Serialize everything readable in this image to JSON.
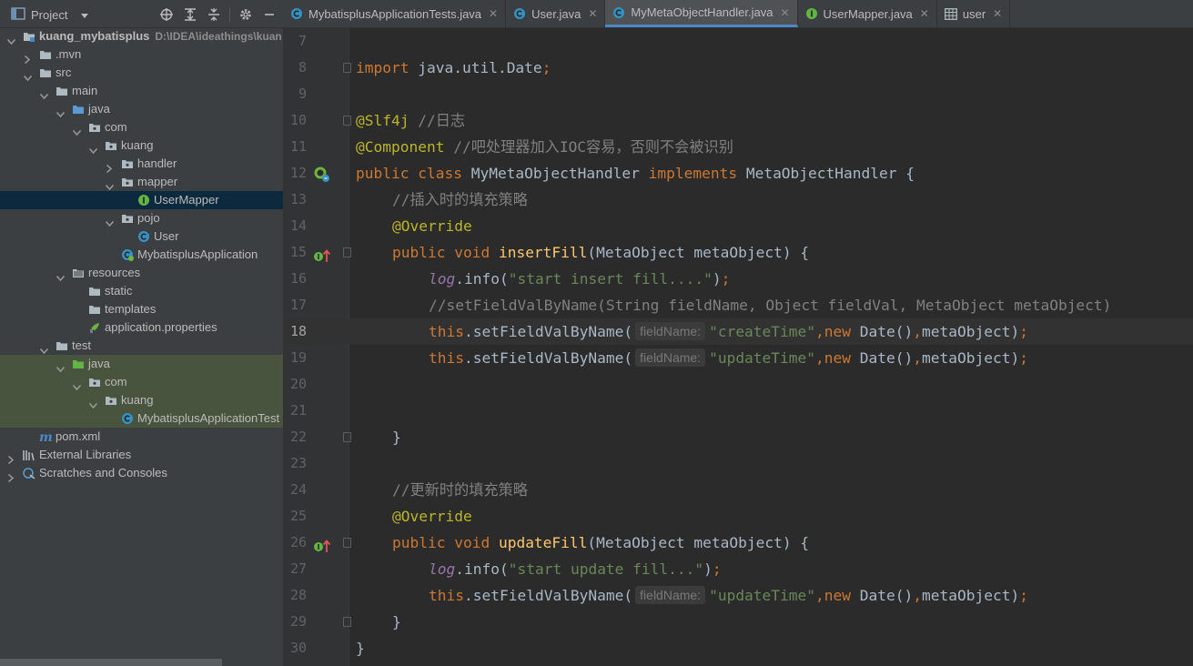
{
  "project": {
    "title": "Project",
    "tree": [
      {
        "label": "kuang_mybatisplus",
        "path": "D:\\IDEA\\ideathings\\kuan",
        "icon": "module-folder-icon",
        "depth": 0,
        "arrow": "down",
        "bold": true
      },
      {
        "label": ".mvn",
        "icon": "folder-icon",
        "depth": 1,
        "arrow": "right"
      },
      {
        "label": "src",
        "icon": "folder-icon",
        "depth": 1,
        "arrow": "down"
      },
      {
        "label": "main",
        "icon": "folder-icon",
        "depth": 2,
        "arrow": "down"
      },
      {
        "label": "java",
        "icon": "source-folder-icon",
        "depth": 3,
        "arrow": "down"
      },
      {
        "label": "com",
        "icon": "package-icon",
        "depth": 4,
        "arrow": "down"
      },
      {
        "label": "kuang",
        "icon": "package-icon",
        "depth": 5,
        "arrow": "down"
      },
      {
        "label": "handler",
        "icon": "package-icon",
        "depth": 6,
        "arrow": "right"
      },
      {
        "label": "mapper",
        "icon": "package-icon",
        "depth": 6,
        "arrow": "down"
      },
      {
        "label": "UserMapper",
        "icon": "interface-icon",
        "depth": 7,
        "arrow": "none",
        "selected": true
      },
      {
        "label": "pojo",
        "icon": "package-icon",
        "depth": 6,
        "arrow": "down"
      },
      {
        "label": "User",
        "icon": "class-icon",
        "depth": 7,
        "arrow": "none"
      },
      {
        "label": "MybatisplusApplication",
        "icon": "spring-boot-class-icon",
        "depth": 6,
        "arrow": "none"
      },
      {
        "label": "resources",
        "icon": "resources-folder-icon",
        "depth": 3,
        "arrow": "down"
      },
      {
        "label": "static",
        "icon": "folder-icon",
        "depth": 4,
        "arrow": "none"
      },
      {
        "label": "templates",
        "icon": "folder-icon",
        "depth": 4,
        "arrow": "none"
      },
      {
        "label": "application.properties",
        "icon": "properties-file-icon",
        "depth": 4,
        "arrow": "none"
      },
      {
        "label": "test",
        "icon": "folder-icon",
        "depth": 2,
        "arrow": "down"
      },
      {
        "label": "java",
        "icon": "test-source-folder-icon",
        "depth": 3,
        "arrow": "down",
        "test": true
      },
      {
        "label": "com",
        "icon": "package-icon",
        "depth": 4,
        "arrow": "down",
        "test": true
      },
      {
        "label": "kuang",
        "icon": "package-icon",
        "depth": 5,
        "arrow": "down",
        "test": true
      },
      {
        "label": "MybatisplusApplicationTest",
        "icon": "test-class-icon",
        "depth": 6,
        "arrow": "none",
        "test": true
      },
      {
        "label": "pom.xml",
        "icon": "maven-icon",
        "depth": 1,
        "arrow": "none"
      },
      {
        "label": "External Libraries",
        "icon": "libraries-icon",
        "depth": 0,
        "arrow": "right"
      },
      {
        "label": "Scratches and Consoles",
        "icon": "scratches-icon",
        "depth": 0,
        "arrow": "right"
      }
    ]
  },
  "tabs": [
    {
      "label": "MybatisplusApplicationTests.java",
      "icon": "class-icon",
      "active": false,
      "closable": true
    },
    {
      "label": "User.java",
      "icon": "class-icon",
      "active": false,
      "closable": true
    },
    {
      "label": "MyMetaObjectHandler.java",
      "icon": "class-icon",
      "active": true,
      "closable": true
    },
    {
      "label": "UserMapper.java",
      "icon": "interface-icon",
      "active": false,
      "closable": true
    },
    {
      "label": "user",
      "icon": "table-icon",
      "active": false,
      "closable": true
    }
  ],
  "editor": {
    "current_line": 18,
    "lines": [
      {
        "n": "7",
        "tokens": []
      },
      {
        "n": "8",
        "fold": true,
        "tokens": [
          [
            "kw",
            "import "
          ],
          [
            "",
            "java.util.Date"
          ],
          [
            "kw",
            ";"
          ]
        ]
      },
      {
        "n": "9",
        "tokens": []
      },
      {
        "n": "10",
        "fold": true,
        "tokens": [
          [
            "ann",
            "@Slf4j "
          ],
          [
            "cmt",
            "//日志"
          ]
        ]
      },
      {
        "n": "11",
        "tokens": [
          [
            "ann",
            "@Component "
          ],
          [
            "cmt",
            "//吧处理器加入IOC容易，否则不会被识别"
          ]
        ]
      },
      {
        "n": "12",
        "mark": "spring-bean-icon",
        "tokens": [
          [
            "kw",
            "public class "
          ],
          [
            "",
            "MyMetaObjectHandler "
          ],
          [
            "kw",
            "implements "
          ],
          [
            "",
            "MetaObjectHandler {"
          ]
        ]
      },
      {
        "n": "13",
        "indent": 1,
        "tokens": [
          [
            "cmt",
            "//插入时的填充策略"
          ]
        ]
      },
      {
        "n": "14",
        "indent": 1,
        "tokens": [
          [
            "ann",
            "@Override"
          ]
        ]
      },
      {
        "n": "15",
        "indent": 1,
        "mark": "implements-method-icon",
        "fold": true,
        "tokens": [
          [
            "kw",
            "public void "
          ],
          [
            "fn",
            "insertFill"
          ],
          [
            "",
            "(MetaObject metaObject) {"
          ]
        ]
      },
      {
        "n": "16",
        "indent": 2,
        "tokens": [
          [
            "fld",
            "log"
          ],
          [
            "",
            ".info("
          ],
          [
            "str",
            "\"start insert fill....\""
          ],
          [
            "",
            ")"
          ],
          [
            "kw",
            ";"
          ]
        ]
      },
      {
        "n": "17",
        "indent": 2,
        "tokens": [
          [
            "cmt",
            "//setFieldValByName(String fieldName, Object fieldVal, MetaObject metaObject)"
          ]
        ]
      },
      {
        "n": "18",
        "indent": 2,
        "tokens": [
          [
            "kw",
            "this"
          ],
          [
            "",
            ".setFieldValByName("
          ],
          [
            "hint",
            "fieldName:"
          ],
          [
            "str",
            "\"createTime\""
          ],
          [
            "kw",
            ",new "
          ],
          [
            "",
            "Date()"
          ],
          [
            "kw",
            ","
          ],
          [
            "",
            "metaObject)"
          ],
          [
            "kw",
            ";"
          ]
        ]
      },
      {
        "n": "19",
        "indent": 2,
        "tokens": [
          [
            "kw",
            "this"
          ],
          [
            "",
            ".setFieldValByName("
          ],
          [
            "hint",
            "fieldName:"
          ],
          [
            "str",
            "\"updateTime\""
          ],
          [
            "kw",
            ",new "
          ],
          [
            "",
            "Date()"
          ],
          [
            "kw",
            ","
          ],
          [
            "",
            "metaObject)"
          ],
          [
            "kw",
            ";"
          ]
        ]
      },
      {
        "n": "20",
        "tokens": []
      },
      {
        "n": "21",
        "tokens": []
      },
      {
        "n": "22",
        "indent": 1,
        "fold": true,
        "tokens": [
          [
            "",
            "}"
          ]
        ]
      },
      {
        "n": "23",
        "tokens": []
      },
      {
        "n": "24",
        "indent": 1,
        "tokens": [
          [
            "cmt",
            "//更新时的填充策略"
          ]
        ]
      },
      {
        "n": "25",
        "indent": 1,
        "tokens": [
          [
            "ann",
            "@Override"
          ]
        ]
      },
      {
        "n": "26",
        "indent": 1,
        "mark": "implements-method-icon",
        "fold": true,
        "tokens": [
          [
            "kw",
            "public void "
          ],
          [
            "fn",
            "updateFill"
          ],
          [
            "",
            "(MetaObject metaObject) {"
          ]
        ]
      },
      {
        "n": "27",
        "indent": 2,
        "tokens": [
          [
            "fld",
            "log"
          ],
          [
            "",
            ".info("
          ],
          [
            "str",
            "\"start update fill...\""
          ],
          [
            "",
            ")"
          ],
          [
            "kw",
            ";"
          ]
        ]
      },
      {
        "n": "28",
        "indent": 2,
        "tokens": [
          [
            "kw",
            "this"
          ],
          [
            "",
            ".setFieldValByName("
          ],
          [
            "hint",
            "fieldName:"
          ],
          [
            "str",
            "\"updateTime\""
          ],
          [
            "kw",
            ",new "
          ],
          [
            "",
            "Date()"
          ],
          [
            "kw",
            ","
          ],
          [
            "",
            "metaObject)"
          ],
          [
            "kw",
            ";"
          ]
        ]
      },
      {
        "n": "29",
        "indent": 1,
        "fold": true,
        "tokens": [
          [
            "",
            "}"
          ]
        ]
      },
      {
        "n": "30",
        "tokens": [
          [
            "",
            "}"
          ]
        ]
      }
    ]
  },
  "colors": {
    "keyword": "#cc7832",
    "annotation": "#bbb529",
    "comment": "#808080",
    "string": "#6a8759",
    "method": "#ffc66d",
    "field": "#9876aa",
    "text": "#a9b7c6",
    "selection": "#0d293e",
    "test_root": "#49543f",
    "tab_underline": "#4a88c7"
  }
}
